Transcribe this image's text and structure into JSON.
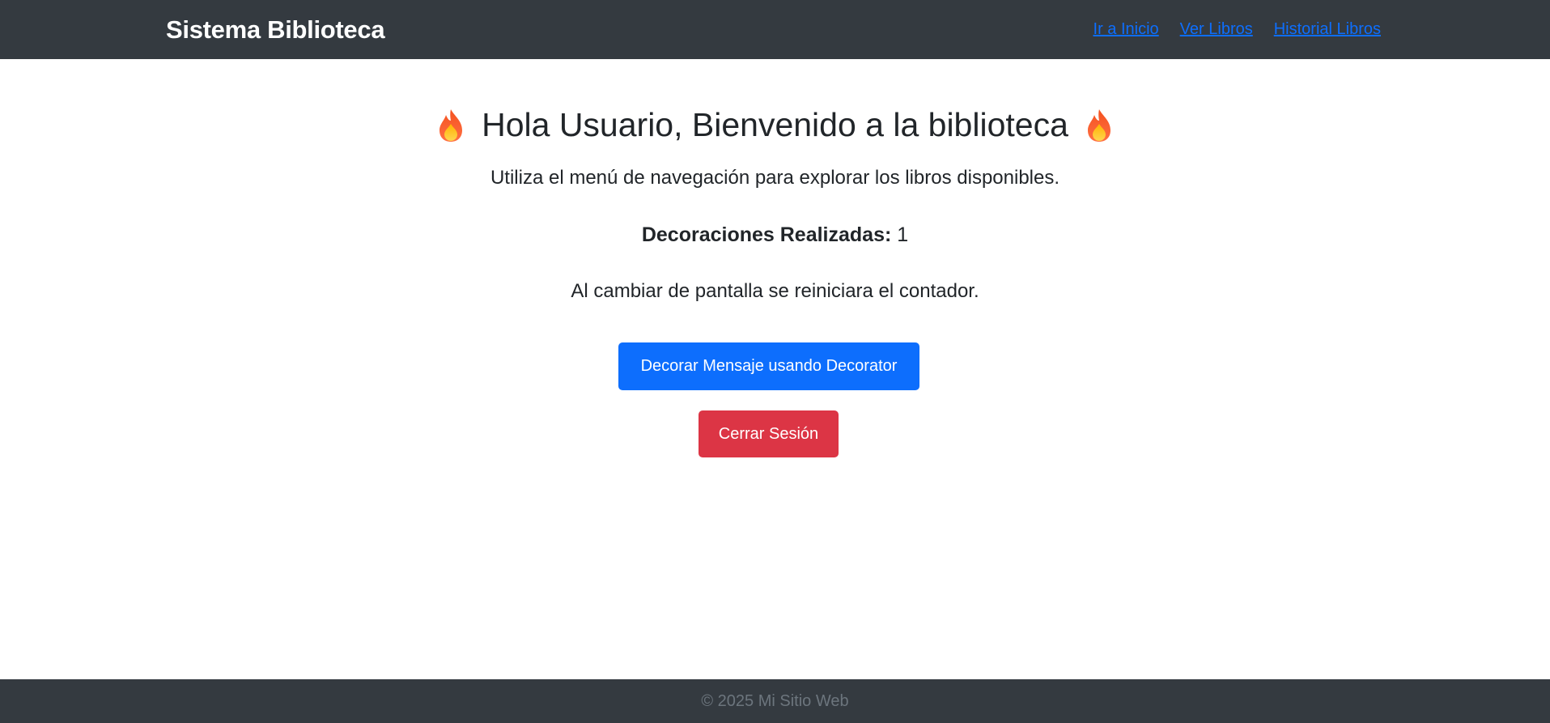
{
  "navbar": {
    "brand": "Sistema Biblioteca",
    "links": [
      {
        "label": "Ir a Inicio"
      },
      {
        "label": "Ver Libros"
      },
      {
        "label": "Historial Libros"
      }
    ]
  },
  "main": {
    "title": "Hola Usuario, Bienvenido a la biblioteca",
    "title_icon": "fire-icon",
    "subtitle": "Utiliza el menú de navegación para explorar los libros disponibles.",
    "counter_label": "Decoraciones Realizadas:",
    "counter_value": "1",
    "note": "Al cambiar de pantalla se reiniciara el contador.",
    "decorate_button": "Decorar Mensaje usando Decorator",
    "logout_button": "Cerrar Sesión"
  },
  "footer": {
    "text": "© 2025 Mi Sitio Web"
  },
  "colors": {
    "navbar_bg": "#343a40",
    "primary": "#0d6efd",
    "danger": "#dc3545"
  }
}
